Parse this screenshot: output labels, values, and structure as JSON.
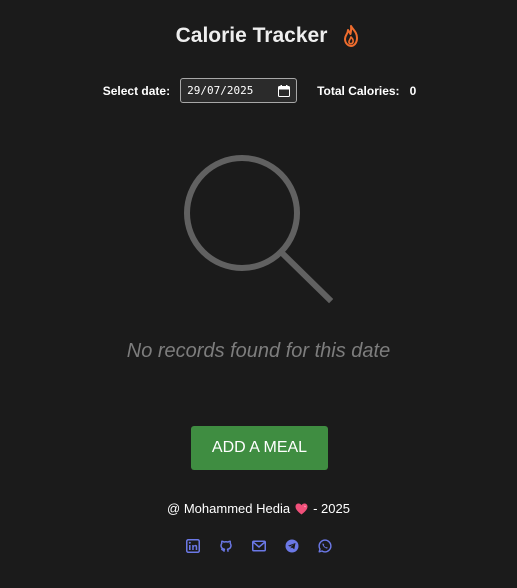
{
  "header": {
    "title": "Calorie Tracker",
    "icon": "flame-icon"
  },
  "controls": {
    "date_label": "Select date:",
    "date_value": "29/07/2025",
    "total_label": "Total Calories:",
    "total_value": "0"
  },
  "empty_state": {
    "icon": "search-icon",
    "message": "No records found for this date"
  },
  "actions": {
    "add_meal_label": "ADD A MEAL"
  },
  "footer": {
    "prefix": "@ Mohammed Hedia",
    "heart": "heart-icon",
    "suffix": "- 2025",
    "socials": [
      "linkedin-icon",
      "github-icon",
      "email-icon",
      "telegram-icon",
      "whatsapp-icon"
    ]
  },
  "colors": {
    "background": "#1b1b1b",
    "accent_green": "#3f8d41",
    "flame": "#ef6c2d",
    "social": "#6b78e6",
    "muted_text": "#7d7d7d"
  }
}
